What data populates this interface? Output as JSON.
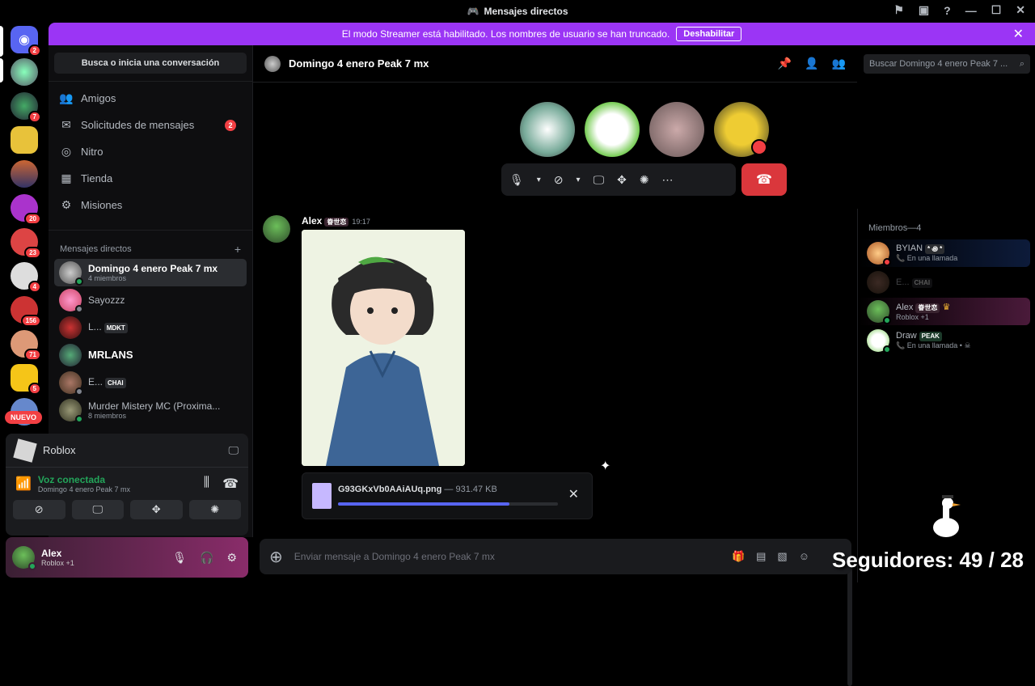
{
  "window": {
    "title": "Mensajes directos"
  },
  "banner": {
    "text": "El modo Streamer está habilitado. Los nombres de usuario se han truncado.",
    "button": "Deshabilitar",
    "close": "✕"
  },
  "servers": {
    "badges": [
      "2",
      "7",
      "20",
      "23",
      "4",
      "156",
      "71",
      "5"
    ],
    "new_label": "NUEVO"
  },
  "sidebar": {
    "search": "Busca o inicia una conversación",
    "nav": [
      {
        "label": "Amigos",
        "icon": "friends-icon"
      },
      {
        "label": "Solicitudes de mensajes",
        "icon": "envelope-icon",
        "count": "2"
      },
      {
        "label": "Nitro",
        "icon": "nitro-icon"
      },
      {
        "label": "Tienda",
        "icon": "shop-icon"
      },
      {
        "label": "Misiones",
        "icon": "missions-icon"
      }
    ],
    "dm_header": "Mensajes directos",
    "dm_add": "+",
    "dms": [
      {
        "name": "Domingo 4 enero Peak 7 mx",
        "sub": "4 miembros"
      },
      {
        "name": "Sayozzz",
        "sub": ""
      },
      {
        "name": "L...",
        "tag": "MDKT",
        "sub": ""
      },
      {
        "name": "MRLANS",
        "sub": ""
      },
      {
        "name": "E...",
        "tag": "CHAI",
        "sub": ""
      },
      {
        "name": "Murder Mistery MC (Proxima...",
        "sub": "8 miembros"
      }
    ]
  },
  "activity": {
    "game": "Roblox"
  },
  "voice": {
    "status": "Voz conectada",
    "channel": "Domingo 4 enero Peak 7 mx"
  },
  "user": {
    "name": "Alex",
    "status": "Roblox +1"
  },
  "channel": {
    "title": "Domingo 4 enero Peak 7 mx",
    "search_placeholder": "Buscar Domingo 4 enero Peak 7 ..."
  },
  "message": {
    "author": "Alex",
    "author_tag": "眷世恋",
    "time": "19:17"
  },
  "upload": {
    "filename": "G93GKxVb0AAiAUq.png",
    "size": " — 931.47 KB",
    "progress": 0.78
  },
  "composer": {
    "placeholder": "Enviar mensaje a Domingo 4 enero Peak 7 mx"
  },
  "members": {
    "header": "Miembros—4",
    "list": [
      {
        "name": "BYIAN",
        "tag": "* ꩜ *",
        "sub": "En una llamada"
      },
      {
        "name": "E...",
        "tag": "CHAI",
        "sub": ""
      },
      {
        "name": "Alex",
        "tag": "眷世恋",
        "sub": "Roblox +1"
      },
      {
        "name": "Draw",
        "tag": "PEAK",
        "sub": "En una llamada •"
      }
    ]
  },
  "overlay": {
    "followers": "Seguidores: 49 / 28"
  },
  "colors": {
    "banner": "#9b35f5",
    "accent": "#5865f2",
    "danger": "#da373c",
    "online": "#23a55a"
  }
}
